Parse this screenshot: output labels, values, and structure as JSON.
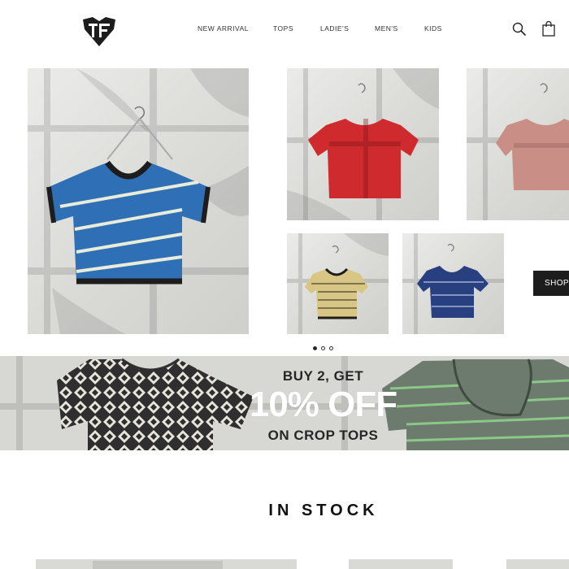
{
  "brand": {
    "logo_letters": "TF"
  },
  "nav": {
    "items": [
      "NEW ARRIVAL",
      "TOPS",
      "LADIE'S",
      "MEN'S",
      "KIDS"
    ]
  },
  "header": {
    "search_icon": "search-icon",
    "cart_icon": "shopping-bag-icon"
  },
  "hero": {
    "products": [
      {
        "name": "blue-striped-crop-top",
        "color": "#2f6fb5",
        "stripe": "#e8ecd8",
        "trim": "#1d1d1d"
      },
      {
        "name": "red-crop-top",
        "color": "#cf2a2e"
      },
      {
        "name": "pink-crop-top",
        "color": "#c98f86"
      },
      {
        "name": "yellow-striped-crop-top",
        "color": "#d9c684",
        "stripe": "#6b6b4a",
        "trim": "#1d1d1d"
      },
      {
        "name": "navy-striped-crop-top",
        "color": "#283f80",
        "stripe": "#8fa1c8"
      }
    ],
    "shop_button": "SHOP",
    "carousel": {
      "count": 3,
      "active": 0
    }
  },
  "promo": {
    "line1": "BUY 2, GET",
    "line2": "10% OFF",
    "line3": "ON CROP TOPS",
    "accent": "#ffffff",
    "text_color": "#262626"
  },
  "in_stock": {
    "title": "IN STOCK"
  }
}
